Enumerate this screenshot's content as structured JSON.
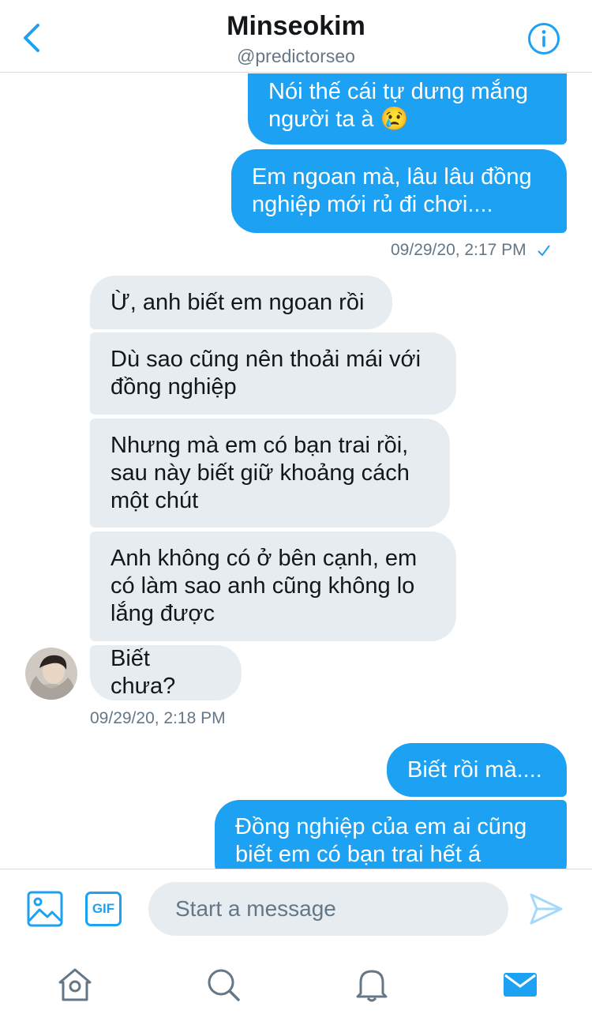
{
  "header": {
    "title": "Minseokim",
    "handle": "@predictorseo"
  },
  "conversation": {
    "sent_group_1": [
      "Nói thế cái tự dưng mắng\nngười ta à 😢",
      "Em ngoan mà, lâu lâu đồng\nnghiệp mới rủ đi chơi...."
    ],
    "sent_group_1_time": "09/29/20, 2:17 PM",
    "received": [
      "Ừ, anh biết em ngoan rồi",
      "Dù sao cũng nên thoải mái với\nđồng nghiệp",
      "Nhưng mà em có bạn trai rồi,\nsau này biết giữ khoảng cách\nmột chút",
      "Anh không có ở bên cạnh, em\ncó làm sao anh cũng không lo\nlắng được",
      "Biết chưa?"
    ],
    "received_time": "09/29/20, 2:18 PM",
    "sent_group_2": [
      "Biết rồi mà....",
      "Đồng nghiệp của em ai cũng\nbiết em có bạn trai hết á"
    ]
  },
  "composer": {
    "gif_label": "GIF",
    "placeholder": "Start a message"
  },
  "icons": {
    "back": "chevron-left-icon",
    "info": "info-icon",
    "image": "image-icon",
    "gif": "gif-icon",
    "send": "send-icon",
    "home": "home-icon",
    "search": "search-icon",
    "notifications": "bell-icon",
    "messages": "mail-icon",
    "read_receipt": "checkmark-icon"
  },
  "colors": {
    "accent": "#1da1f2",
    "received_bubble": "#e6ecf0",
    "muted_text": "#657786"
  }
}
